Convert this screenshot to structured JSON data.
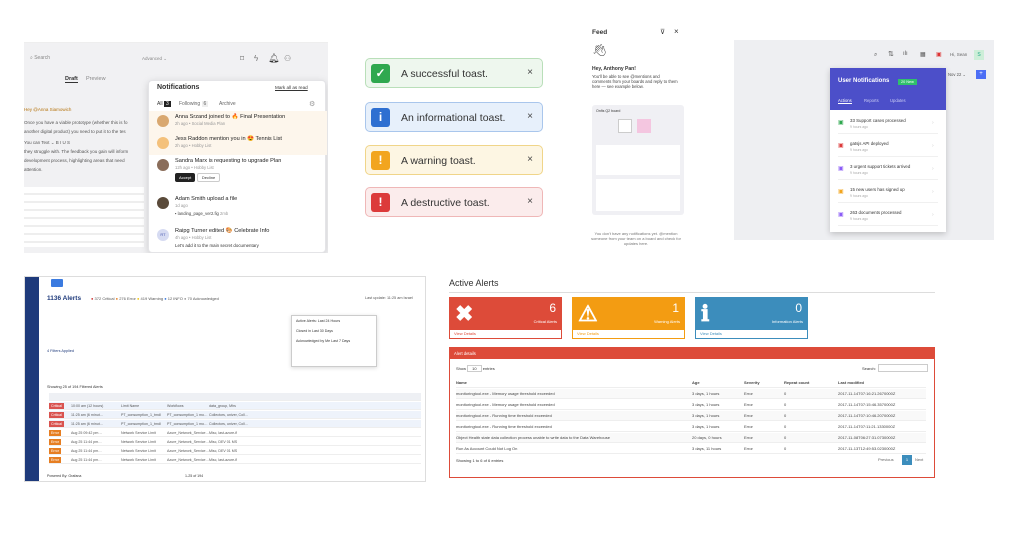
{
  "notifications": {
    "search_placeholder": "Search",
    "advanced": "Advanced ⌄",
    "tab_draft": "Draft",
    "tab_preview": "Preview",
    "title": "Notifications",
    "mark_all": "Mark all as read",
    "tabs": [
      {
        "label": "All",
        "count": "3"
      },
      {
        "label": "Following",
        "count": "6"
      },
      {
        "label": "Archive"
      }
    ],
    "items": [
      {
        "text": "Anna Srzand joined to 🔥 Final Presentation",
        "sub": "2h ago • Social Media Plan"
      },
      {
        "text": "Jess Raddon mention you in 😍 Tennis List",
        "sub": "2h ago • Hobby List"
      },
      {
        "text": "Sandra Marx is requesting to upgrade Plan",
        "sub": "12h ago • Hobby List",
        "accept": "Accept",
        "decline": "Decline"
      },
      {
        "text": "Adam Smith upload a file",
        "sub": "1d ago",
        "file": "landing_page_ver2.fig",
        "size": "2mb"
      },
      {
        "text": "Raipg Turner edited 🎨 Celebrate Info",
        "sub": "4h ago • Hobby List",
        "extra": "Let's add it to the main secret documentary"
      }
    ],
    "editor_lines": [
      "Hey @Anna Siamowich",
      "Once you have a viable prototype (whether this is fo",
      "another digital product) you need to put it to the tes",
      "You can  Text ⌄  B  I  U  S",
      "they struggle with. The feedback you gain will inform",
      "development process, highlighting areas that need",
      "attention."
    ]
  },
  "toasts": [
    {
      "text": "A successful toast.",
      "icon": "✓",
      "bg": "#eef7ee",
      "border": "#b9dfb9",
      "icbg": "#2fa84f"
    },
    {
      "text": "An informational toast.",
      "icon": "i",
      "bg": "#e7f0fb",
      "border": "#a9c6ec",
      "icbg": "#2e6fd1"
    },
    {
      "text": "A warning toast.",
      "icon": "!",
      "bg": "#fdf6e3",
      "border": "#f0d589",
      "icbg": "#f2a51f"
    },
    {
      "text": "A destructive toast.",
      "icon": "!",
      "bg": "#fbecec",
      "border": "#efb7b7",
      "icbg": "#dc3b3b"
    }
  ],
  "close": "×",
  "feed": {
    "title": "Feed",
    "greeting": "Hey, Anthony Pan!",
    "intro": "You'll be able to see @mentions and comments from your boards and reply to them here — see example below.",
    "board": "Onfis Q2 board",
    "footer": "You don't have any notifications yet. @mention someone from your team on a board and check for updates here."
  },
  "user_notif": {
    "title": "User Notifications",
    "badge": "20 New",
    "tabs": [
      "Actions",
      "Reports",
      "Updates"
    ],
    "sam": "Hi, Sean",
    "date": "Nov 22",
    "items": [
      {
        "t": "33 Support cases processed",
        "s": "9 hours ago",
        "c": "#2fa84f"
      },
      {
        "t": "gatsjs API deployed",
        "s": "9 hours ago",
        "c": "#dc3b3b"
      },
      {
        "t": "3 urgent support tickets arrived",
        "s": "9 hours ago",
        "c": "#8b5cf6"
      },
      {
        "t": "15 new users has signed up",
        "s": "9 hours ago",
        "c": "#f2a51f"
      },
      {
        "t": "263 documents processed",
        "s": "9 hours ago",
        "c": "#8b5cf6"
      }
    ]
  },
  "alerts1": {
    "title": "1136 Alerts",
    "critical": "372 Critical",
    "error": "276 Error",
    "warning": "419 Warning",
    "info": "12 INFO",
    "ack": "70 Acknowledged",
    "last_update": "Last update: 11:25 am Israel",
    "showing": "Showing 25 of 194 Filtered Alerts",
    "filters_applied": "4 Filters Applied",
    "menu": [
      "Active Alerts: Last 24 Hours",
      "Closed in Last 30 Days",
      "Acknowledged by Me Last 7 Days"
    ],
    "rows": [
      [
        "Critical",
        "10:00 am (12 hours)",
        "Limit Name",
        "Workflows",
        "data_group, Mhs"
      ],
      [
        "Critical",
        "11:25 am (6 minut…",
        "PT_consumption_1_tmdl",
        "PT_consumption_1 mo…",
        "Collectors, univer, Coll…"
      ],
      [
        "Critical",
        "11:25 am (6 minut…",
        "PT_consumption_1_tmdl",
        "PT_consumption_1 mo…",
        "Collectors, univer, Coll…"
      ],
      [
        "Error",
        "Aug 25 09:42 pm…",
        "Network Service Limit",
        "Azure_Network_Service…",
        "Misc, last-azure-fl"
      ],
      [
        "Error",
        "Aug 25 11:44 pm…",
        "Network Service Limit",
        "Azure_Network_Service…",
        "Misc, DEV 01 MS"
      ],
      [
        "Error",
        "Aug 25 11:44 pm…",
        "Network Service Limit",
        "Azure_Network_Service…",
        "Misc, DEV 01 MS"
      ],
      [
        "Error",
        "Aug 25 11:44 pm…",
        "Network Service Limit",
        "Azure_Network_Service…",
        "Misc, last-azure-fl"
      ]
    ],
    "powered": "Powered By: Grafana",
    "page": "1-25 of 194"
  },
  "active_alerts": {
    "title": "Active Alerts",
    "boxes": [
      {
        "n": "6",
        "l": "Critical Alerts",
        "c": "#dd4b39",
        "icon": "✖"
      },
      {
        "n": "1",
        "l": "Warning Alerts",
        "c": "#f39c12",
        "icon": "⚠"
      },
      {
        "n": "0",
        "l": "Information Alerts",
        "c": "#3c8dbc",
        "icon": "ℹ"
      }
    ],
    "view": "View Details",
    "panel": "Alert details",
    "show": "Show",
    "entries": "entries",
    "per": "10",
    "search": "Search:",
    "headers": [
      "Name",
      "Age",
      "Severity",
      "Repeat count",
      "Last modified"
    ],
    "rows": [
      [
        "monitoringtool.exe - Memory usage threshold exceeded",
        "3 days, 1 hours",
        "Error",
        "0",
        "2017-11-14T07:16:21.2670000Z"
      ],
      [
        "monitoringtool.exe - Memory usage threshold exceeded",
        "3 days, 1 hours",
        "Error",
        "0",
        "2017-11-14T07:15:46.3570000Z"
      ],
      [
        "monitoringtool.exe - Running time threshold exceeded",
        "3 days, 1 hours",
        "Error",
        "0",
        "2017-11-14T07:10:46.2070000Z"
      ],
      [
        "monitoringtool.exe - Running time threshold exceeded",
        "3 days, 1 hours",
        "Error",
        "0",
        "2017-11-14T07:11:21.1330000Z"
      ],
      [
        "Object Health state data collection process unable to write data to the Data Warehouse",
        "20 days, 0 hours",
        "Error",
        "0",
        "2017-11-08T06:27:31.0730000Z"
      ],
      [
        "Run As Account Could Not Log On",
        "3 days, 11 hours",
        "Error",
        "0",
        "2017-11-13T12:49:53.0230000Z"
      ]
    ],
    "info": "Showing 1 to 6 of 6 entries",
    "prev": "Previous",
    "page": "1",
    "next": "Next"
  }
}
